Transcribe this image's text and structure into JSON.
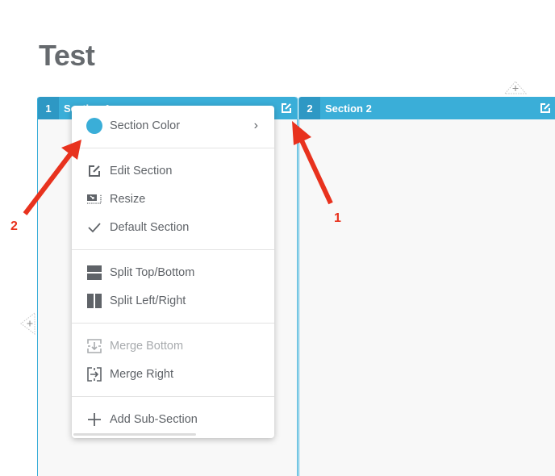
{
  "page": {
    "title": "Test"
  },
  "sections": [
    {
      "number": "1",
      "title": "Section 1"
    },
    {
      "number": "2",
      "title": "Section 2"
    }
  ],
  "colors": {
    "section_blue": "#3aaed8",
    "section_num_bg": "#2e98c4",
    "annotation_red": "#e8321e",
    "section_color_swatch": "#3aaed8"
  },
  "menu": {
    "groups": [
      [
        {
          "label": "Section Color",
          "icon": "color-dot",
          "has_submenu": true
        }
      ],
      [
        {
          "label": "Edit Section",
          "icon": "edit-icon"
        },
        {
          "label": "Resize",
          "icon": "resize-icon"
        },
        {
          "label": "Default Section",
          "icon": "checkmark-icon"
        }
      ],
      [
        {
          "label": "Split Top/Bottom",
          "icon": "split-top-bottom-icon"
        },
        {
          "label": "Split Left/Right",
          "icon": "split-left-right-icon"
        }
      ],
      [
        {
          "label": "Merge Bottom",
          "icon": "merge-bottom-icon",
          "disabled": true
        },
        {
          "label": "Merge Right",
          "icon": "merge-right-icon"
        }
      ],
      [
        {
          "label": "Add Sub-Section",
          "icon": "plus-icon"
        }
      ]
    ]
  },
  "annotations": {
    "one": "1",
    "two": "2"
  }
}
